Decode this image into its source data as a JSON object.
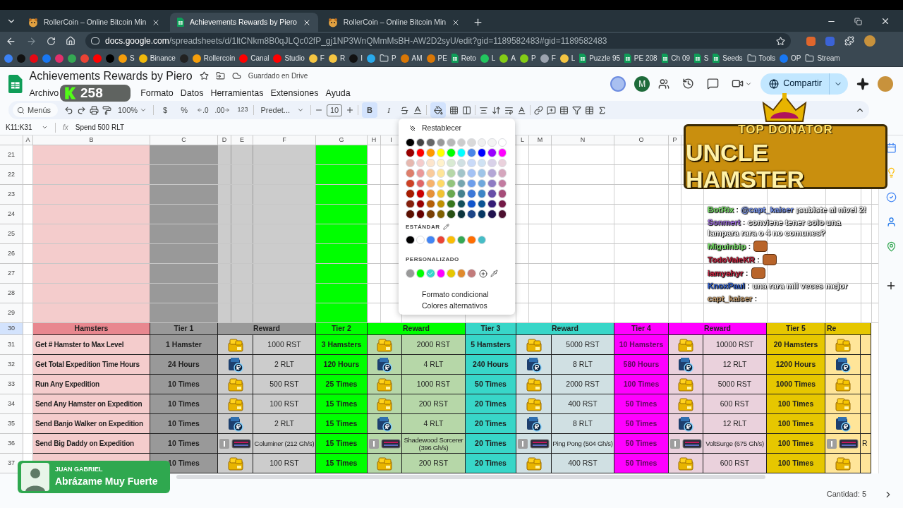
{
  "browser": {
    "tabs": [
      {
        "title": "RollerCoin – Online Bitcoin Min",
        "selected": false,
        "kind": "hamster"
      },
      {
        "title": "Achievements Rewards by Piero",
        "selected": true,
        "kind": "sheets"
      },
      {
        "title": "RollerCoin – Online Bitcoin Min",
        "selected": false,
        "kind": "hamster"
      }
    ],
    "url_domain": "docs.google.com",
    "url_path": "/spreadsheets/d/1ltCNkm8B0qJLQc02fP_gj1NP3WnQMmMsBH-AW2D2syU/edit?gid=1189582483#gid=1189582483",
    "bookmarks": [
      {
        "kind": "site",
        "color": "#3b82f6"
      },
      {
        "kind": "site",
        "color": "#111111"
      },
      {
        "kind": "site",
        "color": "#e50914"
      },
      {
        "kind": "site",
        "color": "#1877f2"
      },
      {
        "kind": "site",
        "color": "#e1306c"
      },
      {
        "kind": "site",
        "color": "#34a853"
      },
      {
        "kind": "site",
        "color": "#ea4335"
      },
      {
        "kind": "site",
        "color": "#ff0000"
      },
      {
        "kind": "site",
        "color": "#000000"
      },
      {
        "kind": "site",
        "color": "#f59e0b",
        "label": "S"
      },
      {
        "kind": "site",
        "color": "#f0b90b",
        "label": "Binance"
      },
      {
        "kind": "site",
        "color": "#222222"
      },
      {
        "kind": "site",
        "color": "#f59e0b",
        "label": "Rollercoin"
      },
      {
        "kind": "site",
        "color": "#ff0000",
        "label": "Canal"
      },
      {
        "kind": "site",
        "color": "#ff0000",
        "label": "Studio"
      },
      {
        "kind": "site",
        "color": "#f5c542",
        "label": "F"
      },
      {
        "kind": "site",
        "color": "#f5c542",
        "label": "R"
      },
      {
        "kind": "site",
        "color": "#111111",
        "label": "I"
      },
      {
        "kind": "site",
        "color": "#29a9eb"
      },
      {
        "kind": "folder",
        "label": "P"
      },
      {
        "kind": "site",
        "color": "#d97706",
        "label": "AM"
      },
      {
        "kind": "site",
        "color": "#d97706",
        "label": "PE"
      },
      {
        "kind": "sheet",
        "label": "Reto"
      },
      {
        "kind": "site",
        "color": "#22c55e",
        "label": "L"
      },
      {
        "kind": "site",
        "color": "#84cc16",
        "label": "A"
      },
      {
        "kind": "site",
        "color": "#84cc16",
        "label": "P"
      },
      {
        "kind": "site",
        "color": "#9ca3af",
        "label": "F"
      },
      {
        "kind": "site",
        "color": "#f5c542",
        "label": "L"
      },
      {
        "kind": "sheet",
        "label": "Puzzle 95"
      },
      {
        "kind": "sheet",
        "label": "PE 208"
      },
      {
        "kind": "sheet",
        "label": "Ch 09"
      },
      {
        "kind": "sheet",
        "label": "S"
      },
      {
        "kind": "sheet",
        "label": "Seeds"
      },
      {
        "kind": "folder",
        "label": "Tools"
      },
      {
        "kind": "site",
        "color": "#1877f2",
        "label": "OP"
      },
      {
        "kind": "folder",
        "label": "Stream"
      }
    ]
  },
  "stream_badge": {
    "count": "258"
  },
  "sheet": {
    "title": "Achievements Rewards by Piero",
    "save_status": "Guardado en Drive",
    "menus": [
      "Archivo",
      "Formato",
      "Datos",
      "Herramientas",
      "Extensiones",
      "Ayuda"
    ],
    "avatar_initial": "M",
    "share_label": "Compartir"
  },
  "toolbar": {
    "search_placeholder": "Menús",
    "zoom": "100%",
    "currency": "$",
    "percent": "%",
    "decrease_decimals": ".0",
    "increase_decimals": ".00",
    "number_format": "123",
    "font": "Predet...",
    "font_size": "10",
    "bold": "B",
    "italic": "I",
    "bold_active": true,
    "fill_active": true
  },
  "formula_bar": {
    "name_box": "K11:K31",
    "fx": "fx",
    "content": "Spend 500 RLT"
  },
  "grid": {
    "column_headers": [
      "A",
      "B",
      "C",
      "D",
      "E",
      "F",
      "G",
      "H",
      "I",
      "L",
      "M",
      "N",
      "O",
      "P"
    ],
    "empty_rows": [
      "21",
      "22",
      "23",
      "24",
      "25",
      "26",
      "27",
      "28",
      "29"
    ],
    "header_row": {
      "number": "30",
      "label": "Hamsters"
    },
    "tiers": [
      {
        "label": "Tier 1",
        "color": "#999999",
        "reward": {
          "header": "Reward",
          "color": "#cccccc"
        }
      },
      {
        "label": "Tier 2",
        "color": "#00ff00",
        "reward": {
          "header": "Reward",
          "color": "#b6d7a8"
        }
      },
      {
        "label": "Tier 3",
        "color": "#38d6c8",
        "reward": {
          "header": "Reward",
          "color": "#d0e0e3"
        }
      },
      {
        "label": "Tier 4",
        "color": "#ff00ff",
        "reward": {
          "header": "Reward",
          "color": "#ead1dc"
        }
      },
      {
        "label": "Tier 5",
        "color": "#e6c700",
        "reward": {
          "header": "Re",
          "color": "#ffe599"
        }
      }
    ],
    "rows": [
      {
        "number": "31",
        "name": "Get # Hamster to Max Level",
        "cells": [
          {
            "requirement": "1 Hamster",
            "kind": "coin",
            "reward": "1000 RST"
          },
          {
            "requirement": "3 Hamsters",
            "kind": "coin",
            "reward": "2000 RST"
          },
          {
            "requirement": "5 Hamsters",
            "kind": "coin",
            "reward": "5000 RST"
          },
          {
            "requirement": "10 Hamsters",
            "kind": "coin",
            "reward": "10000 RST"
          },
          {
            "requirement": "20 Hamsters",
            "kind": "coin"
          }
        ]
      },
      {
        "number": "32",
        "name": "Get Total Expedition Time Hours",
        "cells": [
          {
            "requirement": "24 Hours",
            "kind": "rlt",
            "reward": "2 RLT"
          },
          {
            "requirement": "120 Hours",
            "kind": "rlt",
            "reward": "4 RLT"
          },
          {
            "requirement": "240 Hours",
            "kind": "rlt",
            "reward": "8 RLT"
          },
          {
            "requirement": "580 Hours",
            "kind": "rlt",
            "reward": "12 RLT"
          },
          {
            "requirement": "1200 Hours",
            "kind": "rlt"
          }
        ]
      },
      {
        "number": "33",
        "name": "Run Any Expedition",
        "cells": [
          {
            "requirement": "10 Times",
            "kind": "coin",
            "reward": "500 RST"
          },
          {
            "requirement": "25 Times",
            "kind": "coin",
            "reward": "1000 RST"
          },
          {
            "requirement": "50 Times",
            "kind": "coin",
            "reward": "2000 RST"
          },
          {
            "requirement": "100 Times",
            "kind": "coin",
            "reward": "5000 RST"
          },
          {
            "requirement": "1000 Times",
            "kind": "coin"
          }
        ]
      },
      {
        "number": "34",
        "name": "Send Any Hamster on Expedition",
        "cells": [
          {
            "requirement": "10 Times",
            "kind": "coin",
            "reward": "100 RST"
          },
          {
            "requirement": "15 Times",
            "kind": "coin",
            "reward": "200 RST"
          },
          {
            "requirement": "20 Times",
            "kind": "coin",
            "reward": "400 RST"
          },
          {
            "requirement": "50 Times",
            "kind": "coin",
            "reward": "600 RST"
          },
          {
            "requirement": "100 Times",
            "kind": "coin"
          }
        ]
      },
      {
        "number": "35",
        "name": "Send Banjo Walker on Expedition",
        "cells": [
          {
            "requirement": "10 Times",
            "kind": "rlt",
            "reward": "2 RLT"
          },
          {
            "requirement": "15 Times",
            "kind": "rlt",
            "reward": "4 RLT"
          },
          {
            "requirement": "20 Times",
            "kind": "rlt",
            "reward": "8 RLT"
          },
          {
            "requirement": "50 Times",
            "kind": "rlt",
            "reward": "12 RLT"
          },
          {
            "requirement": "100 Times",
            "kind": "rlt"
          }
        ]
      },
      {
        "number": "36",
        "name": "Send Big Daddy on Expedition",
        "cells": [
          {
            "requirement": "10 Times",
            "kind": "miner",
            "reward": "Columiner (212 Gh/s)"
          },
          {
            "requirement": "15 Times",
            "kind": "miner",
            "reward": "Shadewood Sorcerer (396 Gh/s)"
          },
          {
            "requirement": "20 Times",
            "kind": "miner",
            "reward": "Ping Pong (504 Gh/s)"
          },
          {
            "requirement": "50 Times",
            "kind": "miner",
            "reward": "VoltSurge (675 Gh/s)"
          },
          {
            "requirement": "100 Times",
            "kind": "miner",
            "reward": "R"
          }
        ]
      },
      {
        "number": "37",
        "cells": [
          {
            "requirement": "10 Times",
            "kind": "coin",
            "reward": "100 RST"
          },
          {
            "requirement": "15 Times",
            "kind": "coin",
            "reward": "200 RST"
          },
          {
            "requirement": "20 Times",
            "kind": "coin",
            "reward": "400 RST"
          },
          {
            "requirement": "50 Times",
            "kind": "coin",
            "reward": "600 RST"
          },
          {
            "requirement": "100 Times",
            "kind": "coin"
          }
        ]
      }
    ]
  },
  "color_picker": {
    "reset_label": "Restablecer",
    "palette": [
      {
        "swatches": [
          {
            "color": "#000000"
          },
          {
            "color": "#434343"
          },
          {
            "color": "#666666"
          },
          {
            "color": "#999999"
          },
          {
            "color": "#b7b7b7"
          },
          {
            "color": "#cccccc"
          },
          {
            "color": "#d9d9d9"
          },
          {
            "color": "#efefef"
          },
          {
            "color": "#f3f3f3"
          },
          {
            "color": "#ffffff"
          }
        ]
      },
      {
        "swatches": [
          {
            "color": "#980000"
          },
          {
            "color": "#ff0000"
          },
          {
            "color": "#ff9900"
          },
          {
            "color": "#ffff00"
          },
          {
            "color": "#00ff00"
          },
          {
            "color": "#00ffff"
          },
          {
            "color": "#4a86e8"
          },
          {
            "color": "#0000ff"
          },
          {
            "color": "#9900ff"
          },
          {
            "color": "#ff00ff"
          }
        ]
      },
      {
        "swatches": [
          {
            "color": "#e6b8af"
          },
          {
            "color": "#f4cccc"
          },
          {
            "color": "#fce5cd"
          },
          {
            "color": "#fff2cc"
          },
          {
            "color": "#d9ead3"
          },
          {
            "color": "#d0e0e3"
          },
          {
            "color": "#c9daf8"
          },
          {
            "color": "#cfe2f3"
          },
          {
            "color": "#d9d2e9"
          },
          {
            "color": "#ead1dc"
          }
        ]
      },
      {
        "swatches": [
          {
            "color": "#dd7e6b"
          },
          {
            "color": "#ea9999"
          },
          {
            "color": "#f9cb9c"
          },
          {
            "color": "#ffe599"
          },
          {
            "color": "#b6d7a8"
          },
          {
            "color": "#a2c4c9"
          },
          {
            "color": "#a4c2f4"
          },
          {
            "color": "#9fc5e8"
          },
          {
            "color": "#b4a7d6"
          },
          {
            "color": "#d5a6bd"
          }
        ]
      },
      {
        "swatches": [
          {
            "color": "#cc4125"
          },
          {
            "color": "#e06666"
          },
          {
            "color": "#f6b26b"
          },
          {
            "color": "#ffd966"
          },
          {
            "color": "#93c47d"
          },
          {
            "color": "#76a5af"
          },
          {
            "color": "#6d9eeb"
          },
          {
            "color": "#6fa8dc"
          },
          {
            "color": "#8e7cc3"
          },
          {
            "color": "#c27ba0"
          }
        ]
      },
      {
        "swatches": [
          {
            "color": "#a61c00"
          },
          {
            "color": "#cc0000"
          },
          {
            "color": "#e69138"
          },
          {
            "color": "#f1c232"
          },
          {
            "color": "#6aa84f"
          },
          {
            "color": "#45818e"
          },
          {
            "color": "#3c78d8"
          },
          {
            "color": "#3d85c6"
          },
          {
            "color": "#674ea7"
          },
          {
            "color": "#a64d79"
          }
        ]
      },
      {
        "swatches": [
          {
            "color": "#85200c"
          },
          {
            "color": "#990000"
          },
          {
            "color": "#b45f06"
          },
          {
            "color": "#bf9000"
          },
          {
            "color": "#38761d"
          },
          {
            "color": "#134f5c"
          },
          {
            "color": "#1155cc"
          },
          {
            "color": "#0b5394"
          },
          {
            "color": "#351c75"
          },
          {
            "color": "#741b47"
          }
        ]
      },
      {
        "swatches": [
          {
            "color": "#5b0f00"
          },
          {
            "color": "#660000"
          },
          {
            "color": "#783f04"
          },
          {
            "color": "#7f6000"
          },
          {
            "color": "#274e13"
          },
          {
            "color": "#0c343d"
          },
          {
            "color": "#1c4587"
          },
          {
            "color": "#073763"
          },
          {
            "color": "#20124d"
          },
          {
            "color": "#4c1130"
          }
        ]
      }
    ],
    "standard_label": "ESTÁNDAR",
    "standard": [
      {
        "color": "#000000"
      },
      {
        "color": "#ffffff"
      },
      {
        "color": "#4285f4"
      },
      {
        "color": "#ea4335"
      },
      {
        "color": "#fbbc04"
      },
      {
        "color": "#34a853"
      },
      {
        "color": "#ff6d01"
      },
      {
        "color": "#46bdc6"
      }
    ],
    "custom_label": "PERSONALIZADO",
    "custom": [
      {
        "color": "#999999",
        "selected": false
      },
      {
        "color": "#00ff00",
        "selected": false
      },
      {
        "color": "#38d6c8",
        "selected": true
      },
      {
        "color": "#ff00ff",
        "selected": false
      },
      {
        "color": "#e6c700",
        "selected": false
      },
      {
        "color": "#e08a2c",
        "selected": false
      },
      {
        "color": "#c27b7b",
        "selected": false
      }
    ],
    "actions": [
      "Formato condicional",
      "Colores alternativos"
    ]
  },
  "banner": {
    "top_line": "TOP DONATOR",
    "name": "UNCLE HAMSTER"
  },
  "chat": [
    {
      "user": "BotRix",
      "color": "#7be36b",
      "separator": ":",
      "mention": "@capt_kaiser",
      "text": "¡subiste al nivel 2!",
      "emote": false
    },
    {
      "user": "Sonmert",
      "color": "#a070e0",
      "separator": ":",
      "text": "conviene tener solo una lampara rara o 4 no comunes?",
      "emote": false
    },
    {
      "user": "Miguinbip",
      "color": "#7be36b",
      "separator": ":",
      "emote": true
    },
    {
      "user": "TodoValeKR",
      "color": "#c0203c",
      "separator": ":",
      "emote": true
    },
    {
      "user": "iamyahyr",
      "color": "#c0203c",
      "separator": ":",
      "emote": true
    },
    {
      "user": "KnoxPaul",
      "color": "#3060d0",
      "separator": ":",
      "text": "una rara mil veces mejor",
      "emote": false
    },
    {
      "user": "capt_kaiser",
      "color": "#c8a070",
      "separator": ":",
      "emote": false
    }
  ],
  "now_playing": {
    "artist": "JUAN GABRIEL",
    "title": "Abrázame Muy Fuerte"
  },
  "status_bar": {
    "count": "Cantidad: 5"
  }
}
